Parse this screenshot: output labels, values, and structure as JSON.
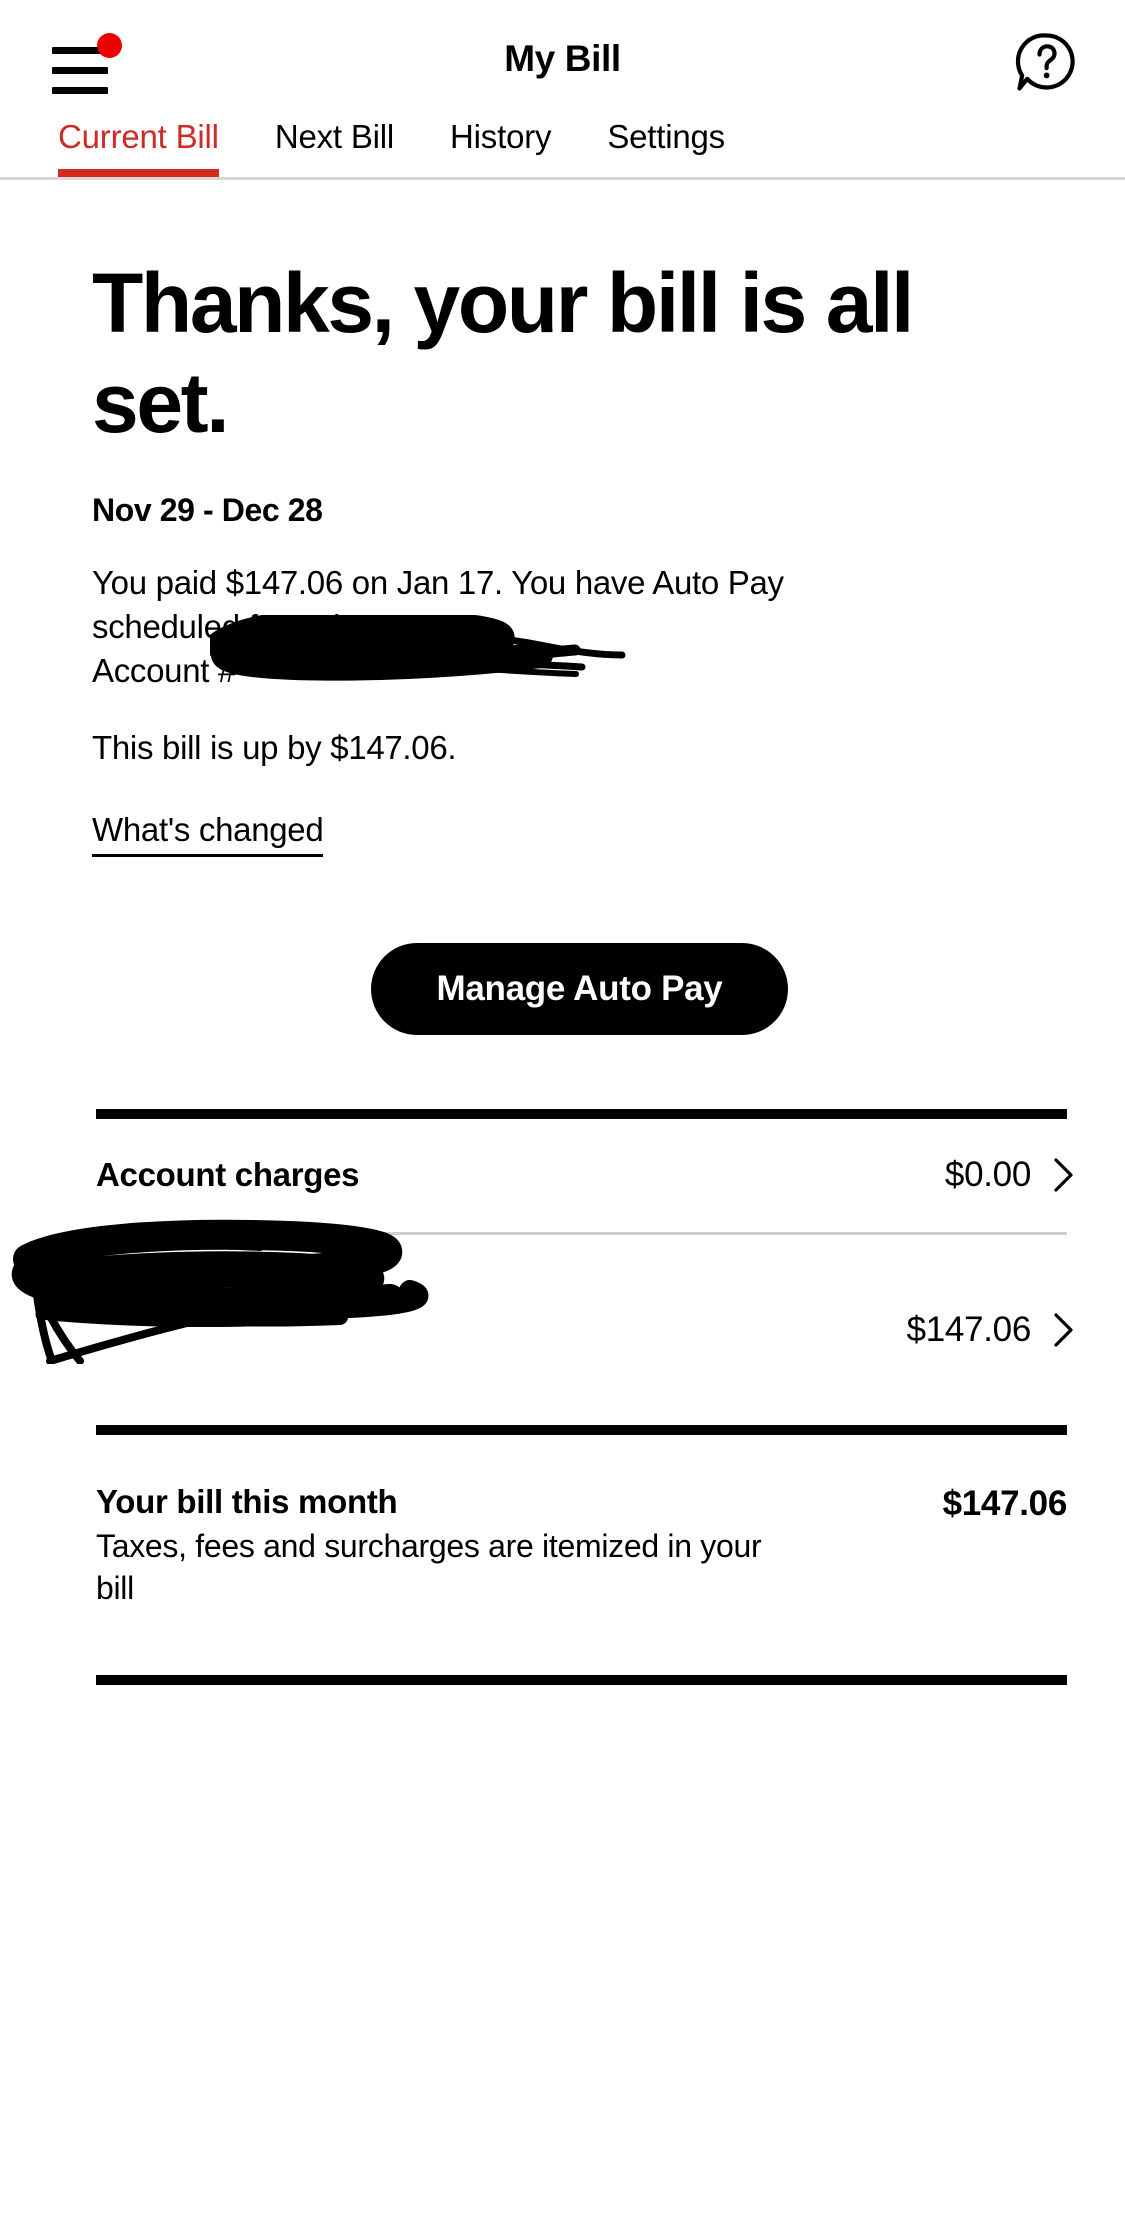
{
  "header": {
    "title": "My Bill",
    "menu_icon": "hamburger-menu-icon",
    "menu_badge": "notification-dot",
    "help_icon": "help-question-bubble-icon"
  },
  "tabs": [
    {
      "label": "Current Bill",
      "active": true
    },
    {
      "label": "Next Bill",
      "active": false
    },
    {
      "label": "History",
      "active": false
    },
    {
      "label": "Settings",
      "active": false
    }
  ],
  "hero": {
    "title": "Thanks, your bill is all set.",
    "cycle_range": "Nov 29 - Dec 28",
    "payment_status": "You paid $147.06 on Jan 17. You have Auto Pay scheduled for Feb 17.",
    "account_line": "Account #",
    "account_number_redacted": "",
    "bill_delta": "This bill is up by $147.06.",
    "whats_changed_link": "What's changed"
  },
  "cta": {
    "manage_auto_pay": "Manage Auto Pay"
  },
  "charges": [
    {
      "label": "Account charges",
      "amount": "$0.00",
      "redacted": false,
      "chevron": "chevron-right-icon"
    },
    {
      "label": "",
      "amount": "$147.06",
      "redacted": true,
      "chevron": "chevron-right-icon"
    }
  ],
  "summary": {
    "title": "Your bill this month",
    "note": "Taxes, fees and surcharges are itemized in your bill",
    "amount": "$147.06"
  },
  "colors": {
    "brand_red": "#d52b1e",
    "active_tab_text": "#cd2b26",
    "badge_red": "#ee0000",
    "text": "#000000",
    "rule_light": "#cfcfcf",
    "cta_bg": "#000000",
    "cta_text": "#ffffff"
  }
}
